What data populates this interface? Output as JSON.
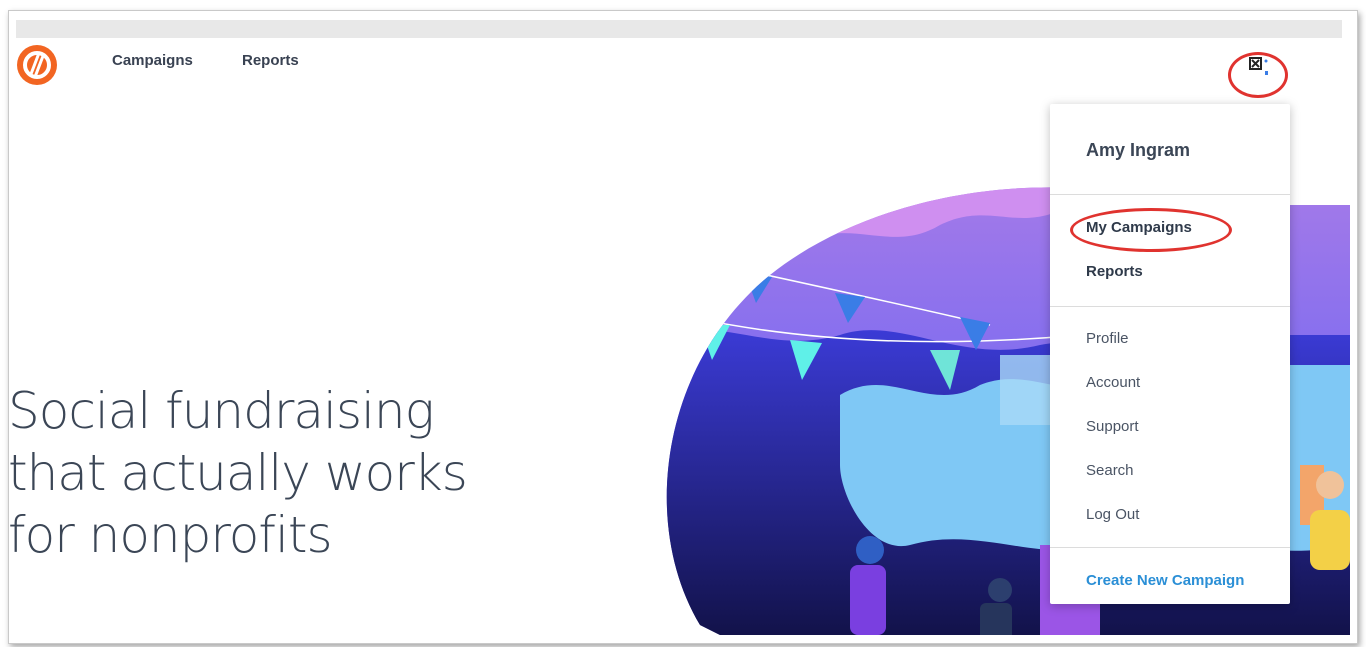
{
  "nav": {
    "logo": "nonprofit-logo",
    "links": [
      "Campaigns",
      "Reports"
    ]
  },
  "hero": {
    "line1": "Social fundraising",
    "line2": "that actually works",
    "line3": "for nonprofits"
  },
  "account_menu": {
    "icon": "user-account-icon",
    "user_name": "Amy Ingram",
    "primary_items": [
      "My Campaigns",
      "Reports"
    ],
    "secondary_items": [
      "Profile",
      "Account",
      "Support",
      "Search",
      "Log Out"
    ],
    "cta": "Create New Campaign"
  },
  "colors": {
    "brand_orange": "#f26522",
    "link_blue": "#2b8fd6",
    "highlight_ring": "#e0332f",
    "text_dark": "#3b4656"
  }
}
